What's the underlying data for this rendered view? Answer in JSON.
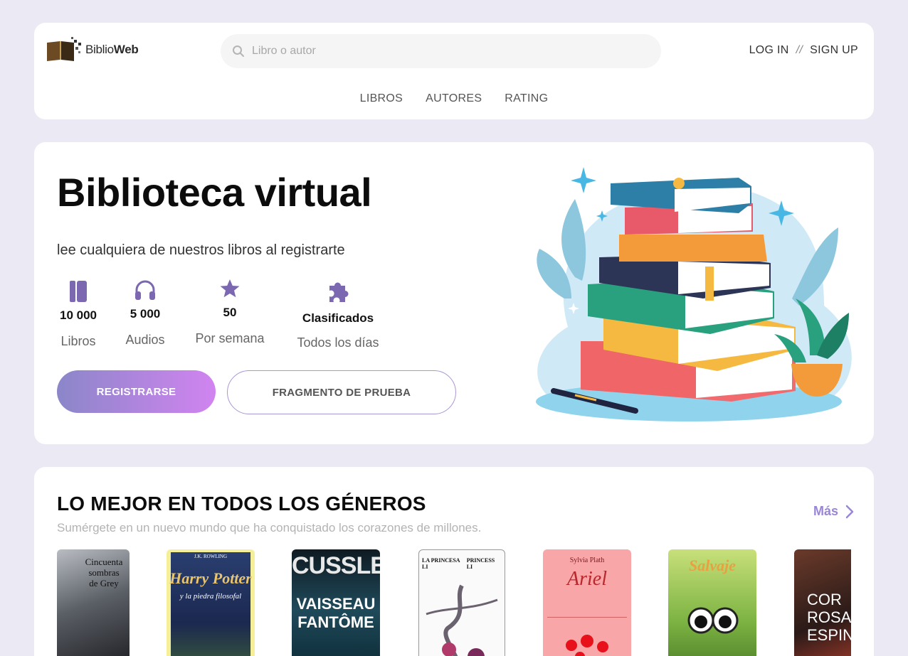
{
  "header": {
    "logo": {
      "brand_a": "Biblio",
      "brand_b": "Web"
    },
    "search": {
      "placeholder": "Libro o autor"
    },
    "auth": {
      "login": "LOG IN",
      "separator": "//",
      "signup": "SIGN UP"
    },
    "nav": [
      "LIBROS",
      "AUTORES",
      "RATING"
    ]
  },
  "hero": {
    "title": "Biblioteca virtual",
    "subtitle": "lee cualquiera de nuestros libros al registrarte",
    "stats": [
      {
        "icon": "book-icon",
        "value": "10 000",
        "label": "Libros"
      },
      {
        "icon": "headphones-icon",
        "value": "5 000",
        "label": "Audios"
      },
      {
        "icon": "star-icon",
        "value": "50",
        "label": "Por semana"
      },
      {
        "icon": "puzzle-icon",
        "value": "Clasificados",
        "label": "Todos los días"
      }
    ],
    "primary_button": "REGISTRARSE",
    "secondary_button": "FRAGMENTO DE PRUEBA"
  },
  "genres": {
    "title": "LO MEJOR EN TODOS LOS GÉNEROS",
    "subtitle": "Sumérgete en un nuevo mundo que ha conquistado los corazones de millones.",
    "more": "Más",
    "books": [
      {
        "cover_text": [
          "Cincuenta",
          "sombras",
          "de Grey"
        ]
      },
      {
        "cover_text": [
          "J.K. ROWLING",
          "Harry Potter",
          "y la piedra filosofal"
        ]
      },
      {
        "cover_text": [
          "CUSSLER",
          "VAISSEAU",
          "FANTÔME"
        ]
      },
      {
        "cover_text": [
          "LA PRINCESA LI",
          "PRINCESS LI"
        ]
      },
      {
        "cover_text": [
          "Sylvia Plath",
          "Ariel"
        ]
      },
      {
        "cover_text": [
          "Salvaje"
        ]
      },
      {
        "cover_text": [
          "COR",
          "ROSA",
          "ESPIN"
        ]
      }
    ]
  },
  "colors": {
    "background": "#ebe9f4",
    "accent": "#9a86d8",
    "icon": "#7b68b0",
    "button_gradient_start": "#8b86c9",
    "button_gradient_end": "#d184f0"
  }
}
